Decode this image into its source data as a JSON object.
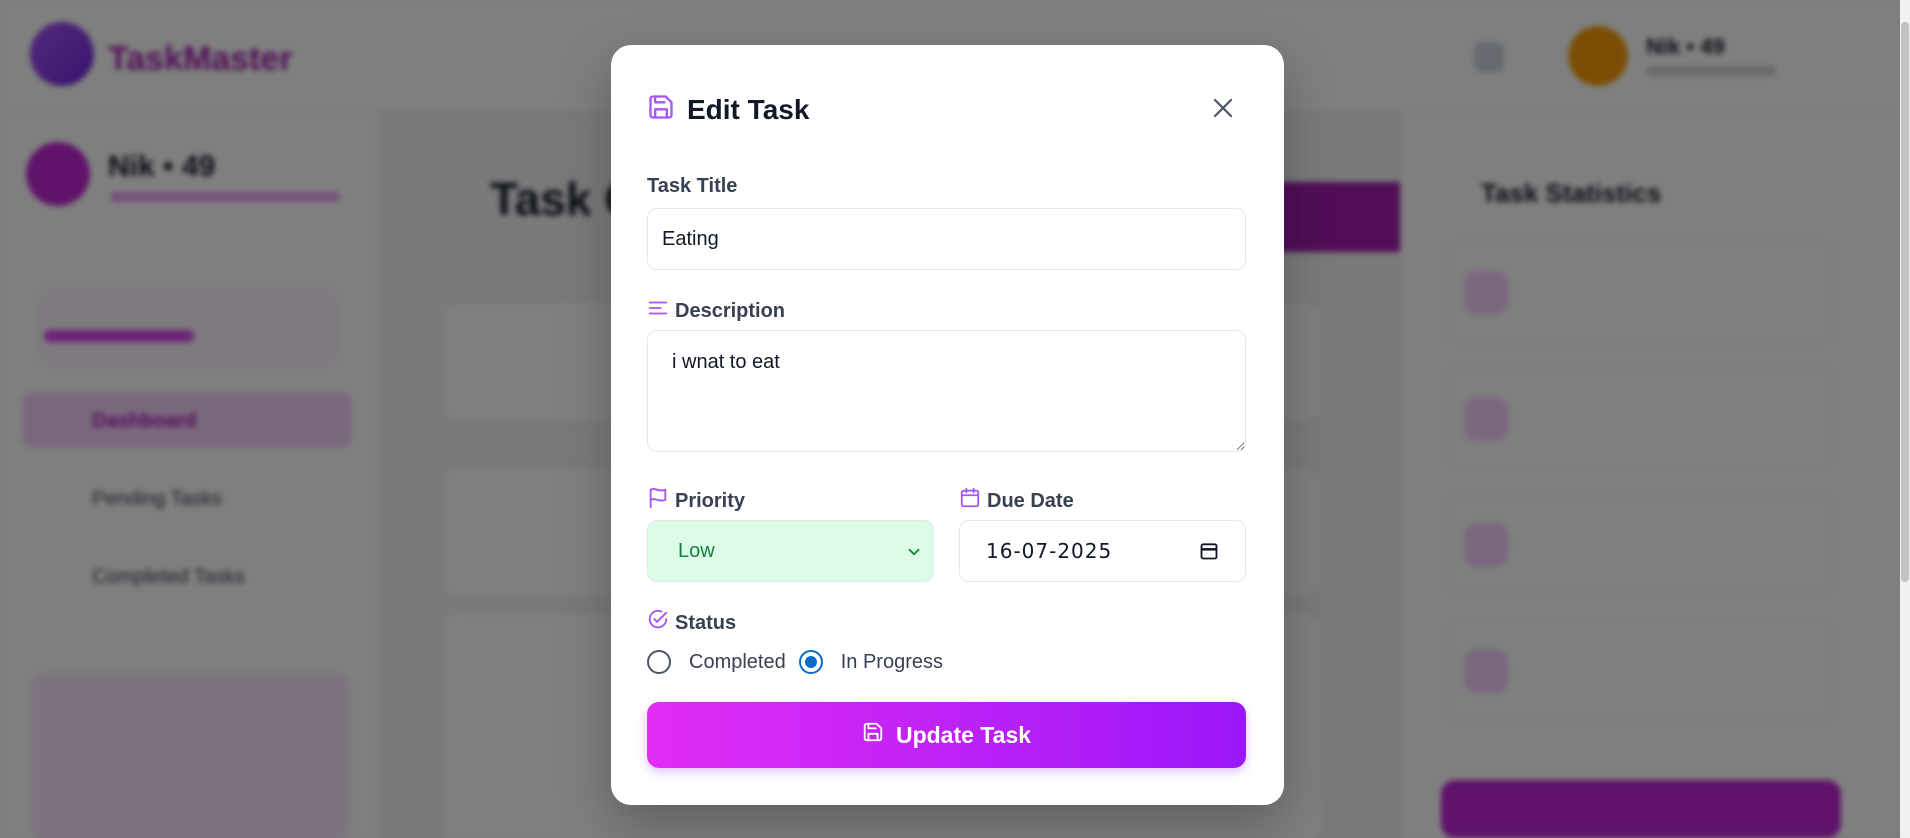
{
  "background": {
    "app_name": "TaskMaster",
    "user_name": "Nik • 49",
    "sidebar_nav": [
      "Dashboard",
      "Pending Tasks",
      "Completed Tasks"
    ],
    "main_title": "Task Overview",
    "right_title": "Task Statistics"
  },
  "modal": {
    "title": "Edit Task",
    "title_icon": "save-icon",
    "close_icon": "close-icon",
    "fields": {
      "title_label": "Task Title",
      "title_value": "Eating",
      "description_label": "Description",
      "description_value": "i wnat to eat",
      "priority_label": "Priority",
      "priority_value": "Low",
      "due_date_label": "Due Date",
      "due_date_value": "16-07-2025",
      "status_label": "Status",
      "status_options": [
        {
          "label": "Completed",
          "checked": false
        },
        {
          "label": "In Progress",
          "checked": true
        }
      ]
    },
    "submit_label": "Update Task"
  },
  "colors": {
    "accent": "#a855f7",
    "button_gradient_start": "#e22df5",
    "button_gradient_end": "#9b17f8",
    "priority_low_bg": "#dcfce7",
    "priority_low_text": "#15803d",
    "radio_checked": "#0b6bcb"
  }
}
